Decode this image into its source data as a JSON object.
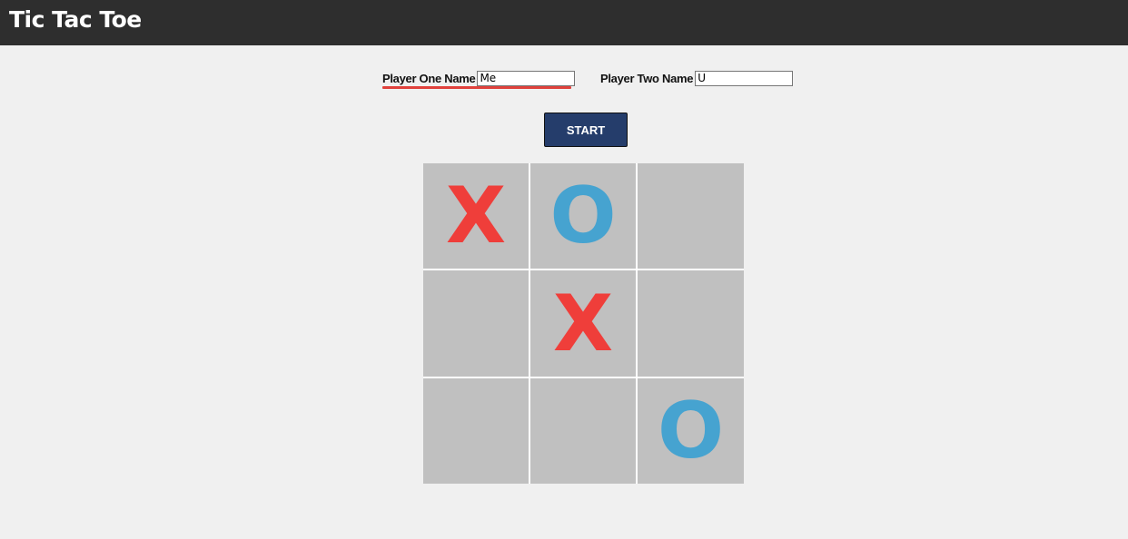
{
  "header": {
    "title": "Tic Tac Toe"
  },
  "players": {
    "one": {
      "label": "Player One Name",
      "value": "Me"
    },
    "two": {
      "label": "Player Two Name",
      "value": "U"
    }
  },
  "controls": {
    "start_label": "START"
  },
  "board": {
    "cells": [
      "X",
      "O",
      "",
      "",
      "X",
      "",
      "",
      "",
      "O"
    ]
  },
  "colors": {
    "header_bg": "#2e2e2e",
    "page_bg": "#f0f0f0",
    "start_button": "#253d6b",
    "x_mark": "#ef3e3a",
    "o_mark": "#46a3d0",
    "cell_bg": "#c0c0c0",
    "active_underline": "#e0413c"
  }
}
